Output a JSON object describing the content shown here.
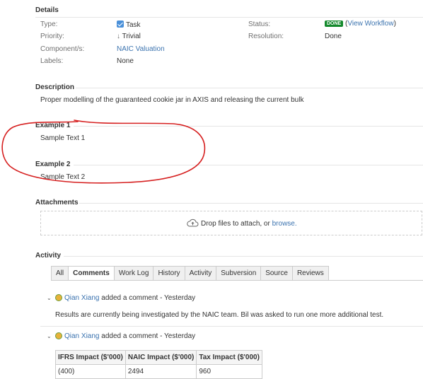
{
  "details": {
    "heading": "Details",
    "type_label": "Type:",
    "type_value": "Task",
    "priority_label": "Priority:",
    "priority_value": "Trivial",
    "components_label": "Component/s:",
    "components_value": "NAIC Valuation",
    "labels_label": "Labels:",
    "labels_value": "None",
    "status_label": "Status:",
    "status_badge": "DONE",
    "status_paren_open": "(",
    "status_link": "View Workflow",
    "status_paren_close": ")",
    "resolution_label": "Resolution:",
    "resolution_value": "Done"
  },
  "description": {
    "heading": "Description",
    "text": "Proper modelling of the guaranteed cookie jar in AXIS and releasing the current bulk"
  },
  "example1": {
    "heading": "Example 1",
    "text": "Sample Text 1"
  },
  "example2": {
    "heading": "Example 2",
    "text": "Sample Text 2"
  },
  "attachments": {
    "heading": "Attachments",
    "drop_text": "Drop files to attach, or ",
    "browse_link": "browse."
  },
  "activity": {
    "heading": "Activity",
    "tabs": [
      "All",
      "Comments",
      "Work Log",
      "History",
      "Activity",
      "Subversion",
      "Source",
      "Reviews"
    ],
    "active_tab": "Comments",
    "comments": [
      {
        "author": "Qian Xiang",
        "action": " added a comment - Yesterday",
        "body": "Results are currently being investigated by the NAIC team. Bil was asked to run one more additional test."
      },
      {
        "author": "Qian Xiang",
        "action": " added a comment - Yesterday",
        "table": {
          "headers": [
            "IFRS Impact ($'000)",
            "NAIC Impact ($'000)",
            "Tax Impact ($'000)"
          ],
          "rows": [
            [
              "(400)",
              "2494",
              "960"
            ]
          ]
        }
      }
    ]
  },
  "colors": {
    "link": "#3b73af",
    "done_badge": "#14892c",
    "annotation": "#d62020"
  }
}
